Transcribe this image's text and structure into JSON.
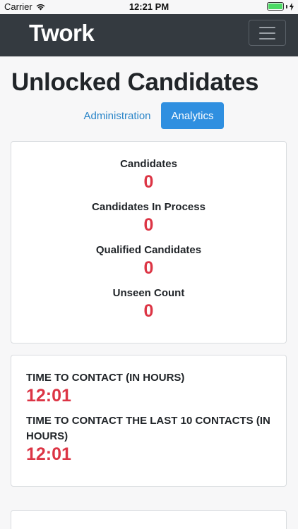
{
  "status_bar": {
    "carrier": "Carrier",
    "time": "12:21 PM",
    "wifi_icon": "wifi-icon",
    "battery_icon": "battery-icon"
  },
  "navbar": {
    "brand": "Twork",
    "menu_icon": "hamburger-menu-icon"
  },
  "page": {
    "title": "Unlocked Candidates"
  },
  "tabs": [
    {
      "label": "Administration",
      "active": false
    },
    {
      "label": "Analytics",
      "active": true
    }
  ],
  "stats": [
    {
      "label": "Candidates",
      "value": "0"
    },
    {
      "label": "Candidates In Process",
      "value": "0"
    },
    {
      "label": "Qualified Candidates",
      "value": "0"
    },
    {
      "label": "Unseen Count",
      "value": "0"
    }
  ],
  "times": [
    {
      "label": "TIME TO CONTACT (IN HOURS)",
      "value": "12:01"
    },
    {
      "label": "TIME TO CONTACT THE LAST 10 CONTACTS (IN HOURS)",
      "value": "12:01"
    }
  ],
  "colors": {
    "navbar_bg": "#343a40",
    "accent_blue": "#2f8fe0",
    "value_red": "#dc3545"
  }
}
